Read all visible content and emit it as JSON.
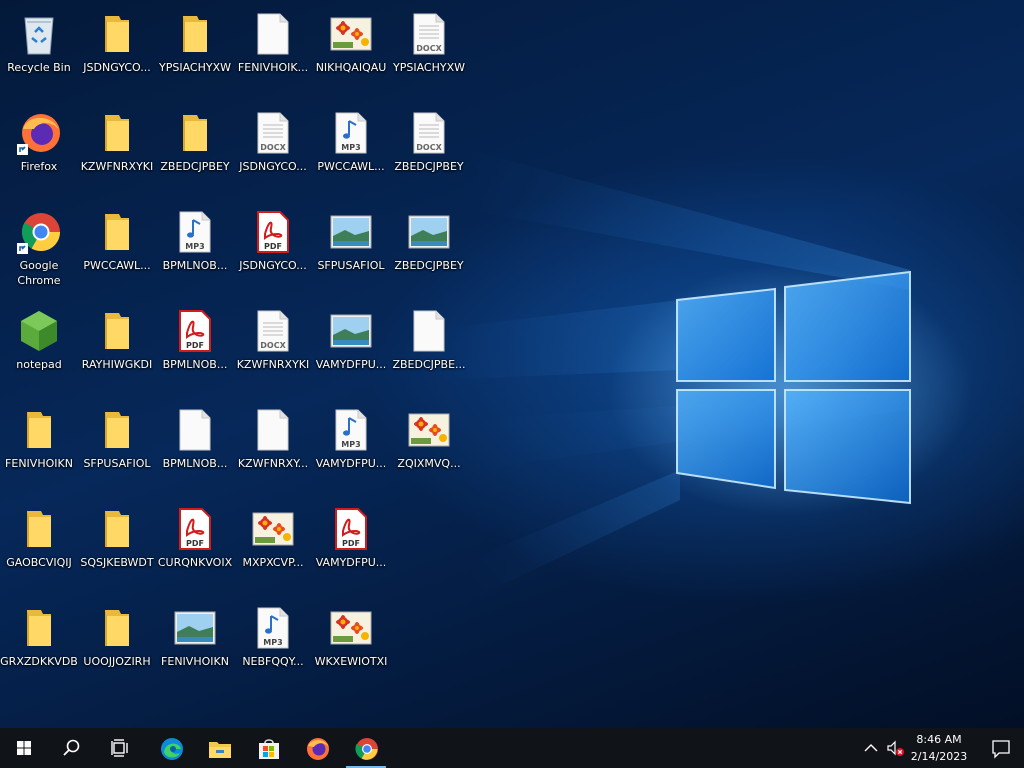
{
  "desktop": {
    "icons": [
      {
        "label": "Recycle Bin",
        "type": "recycle-bin"
      },
      {
        "label": "JSDNGYCO...",
        "type": "folder"
      },
      {
        "label": "YPSIACHYXW",
        "type": "folder"
      },
      {
        "label": "FENIVHOIK...",
        "type": "blank-file"
      },
      {
        "label": "NIKHQAIQAU",
        "type": "image-flower"
      },
      {
        "label": "YPSIACHYXW",
        "type": "docx"
      },
      {
        "label": "Firefox",
        "type": "firefox-shortcut"
      },
      {
        "label": "KZWFNRXYKI",
        "type": "folder"
      },
      {
        "label": "ZBEDCJPBEY",
        "type": "folder"
      },
      {
        "label": "JSDNGYCO...",
        "type": "docx"
      },
      {
        "label": "PWCCAWL...",
        "type": "mp3"
      },
      {
        "label": "ZBEDCJPBEY",
        "type": "docx"
      },
      {
        "label": "Google Chrome",
        "type": "chrome-shortcut"
      },
      {
        "label": "PWCCAWL...",
        "type": "folder"
      },
      {
        "label": "BPMLNOB...",
        "type": "mp3"
      },
      {
        "label": "JSDNGYCO...",
        "type": "pdf"
      },
      {
        "label": "SFPUSAFIOL",
        "type": "image-landscape"
      },
      {
        "label": "ZBEDCJPBEY",
        "type": "image-landscape"
      },
      {
        "label": "notepad",
        "type": "notepad"
      },
      {
        "label": "RAYHIWGKDI",
        "type": "folder"
      },
      {
        "label": "BPMLNOB...",
        "type": "pdf"
      },
      {
        "label": "KZWFNRXYKI",
        "type": "docx"
      },
      {
        "label": "VAMYDFPU...",
        "type": "image-landscape"
      },
      {
        "label": "ZBEDCJPBE...",
        "type": "blank-file"
      },
      {
        "label": "FENIVHOIKN",
        "type": "folder"
      },
      {
        "label": "SFPUSAFIOL",
        "type": "folder"
      },
      {
        "label": "BPMLNOB...",
        "type": "blank-file"
      },
      {
        "label": "KZWFNRXY...",
        "type": "blank-file"
      },
      {
        "label": "VAMYDFPU...",
        "type": "mp3"
      },
      {
        "label": "ZQIXMVQ...",
        "type": "image-flower"
      },
      {
        "label": "GAOBCVIQIJ",
        "type": "folder"
      },
      {
        "label": "SQSJKEBWDT",
        "type": "folder"
      },
      {
        "label": "CURQNKVOIX",
        "type": "pdf"
      },
      {
        "label": "MXPXCVP...",
        "type": "image-flower"
      },
      {
        "label": "VAMYDFPU...",
        "type": "pdf"
      },
      {
        "label": "GRXZDKKVDB",
        "type": "folder"
      },
      {
        "label": "UOOJJOZIRH",
        "type": "folder"
      },
      {
        "label": "FENIVHOIKN",
        "type": "image-landscape"
      },
      {
        "label": "NEBFQQY...",
        "type": "mp3"
      },
      {
        "label": "WKXEWIOTXI",
        "type": "image-flower"
      }
    ]
  },
  "taskbar": {
    "start": "start-icon",
    "search": "search-icon",
    "task_view": "task-view-icon",
    "pinned": [
      "edge-icon",
      "file-explorer-icon",
      "store-icon",
      "firefox-icon",
      "chrome-icon"
    ],
    "active_app": "chrome-icon",
    "tray": {
      "time": "8:46 AM",
      "date": "2/14/2023",
      "volume": "muted",
      "show_hidden": "chevron-up-icon",
      "notifications": "action-center-icon"
    }
  }
}
